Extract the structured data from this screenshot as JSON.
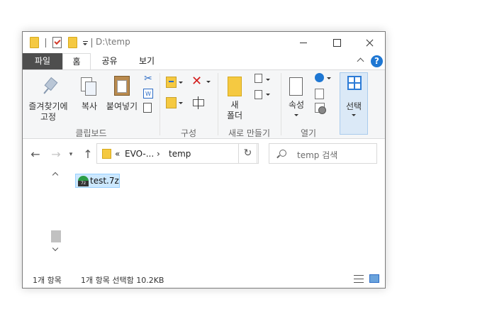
{
  "window": {
    "title": "D:\\temp"
  },
  "tabs": {
    "file": "파일",
    "home": "홈",
    "share": "공유",
    "view": "보기"
  },
  "ribbon": {
    "pin_label_1": "즐겨찾기에",
    "pin_label_2": "고정",
    "copy_label": "복사",
    "paste_label": "붙여넣기",
    "group_clipboard": "클립보드",
    "group_organize": "구성",
    "newfolder_label_1": "새",
    "newfolder_label_2": "폴더",
    "group_new": "새로 만들기",
    "properties_label": "속성",
    "group_open": "열기",
    "select_label": "선택"
  },
  "address": {
    "chevrons": "«",
    "crumb_parent": "EVO-...",
    "separator": "›",
    "crumb_current": "temp",
    "search_placeholder": "temp 검색"
  },
  "files": [
    {
      "name": "test.7z",
      "icon": "7z-archive-icon",
      "selected": true
    }
  ],
  "status": {
    "count": "1개 항목",
    "selection": "1개 항목 선택함 10.2KB"
  },
  "colors": {
    "selection_bg": "#cce8ff",
    "file_tab": "#4e4e4e",
    "accent": "#1e77d3"
  }
}
